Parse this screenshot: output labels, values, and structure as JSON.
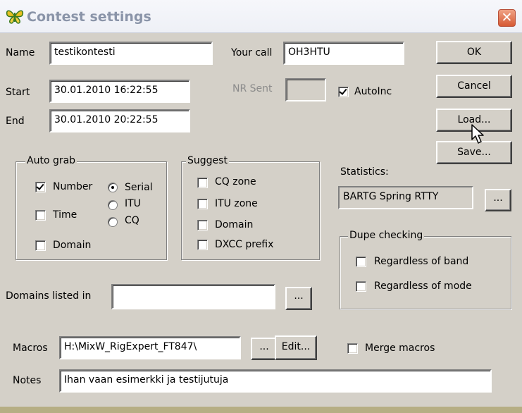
{
  "window": {
    "title": "Contest settings",
    "close_glyph": "✕",
    "icon": "butterfly-icon"
  },
  "fields": {
    "name": {
      "label": "Name",
      "value": "testikontesti"
    },
    "your_call": {
      "label": "Your call",
      "value": "OH3HTU"
    },
    "start": {
      "label": "Start",
      "value": "30.01.2010 16:22:55"
    },
    "nr_sent": {
      "label": "NR Sent",
      "value": ""
    },
    "end": {
      "label": "End",
      "value": "30.01.2010 20:22:55"
    },
    "domains_listed_in": {
      "label": "Domains listed in",
      "value": ""
    },
    "macros": {
      "label": "Macros",
      "value": "H:\\MixW_RigExpert_FT847\\"
    },
    "notes": {
      "label": "Notes",
      "value": "Ihan vaan esimerkki ja testijutuja"
    }
  },
  "autoinc": {
    "label": "AutoInc",
    "checked": true
  },
  "buttons": {
    "ok": "OK",
    "cancel": "Cancel",
    "load": "Load...",
    "save": "Save...",
    "browse": "...",
    "edit": "Edit..."
  },
  "auto_grab": {
    "title": "Auto grab",
    "checkboxes": [
      {
        "label": "Number",
        "checked": true
      },
      {
        "label": "Time",
        "checked": false
      },
      {
        "label": "Domain",
        "checked": false
      }
    ],
    "radios": [
      {
        "label": "Serial",
        "checked": true
      },
      {
        "label": "ITU",
        "checked": false
      },
      {
        "label": "CQ",
        "checked": false
      }
    ]
  },
  "suggest": {
    "title": "Suggest",
    "checkboxes": [
      {
        "label": "CQ zone",
        "checked": false
      },
      {
        "label": "ITU zone",
        "checked": false
      },
      {
        "label": "Domain",
        "checked": false
      },
      {
        "label": "DXCC prefix",
        "checked": false
      }
    ]
  },
  "statistics": {
    "label": "Statistics:",
    "value": "BARTG Spring RTTY"
  },
  "dupe_checking": {
    "title": "Dupe checking",
    "checkboxes": [
      {
        "label": "Regardless of band",
        "checked": false
      },
      {
        "label": "Regardless of mode",
        "checked": false
      }
    ]
  },
  "merge_macros": {
    "label": "Merge macros",
    "checked": false
  }
}
